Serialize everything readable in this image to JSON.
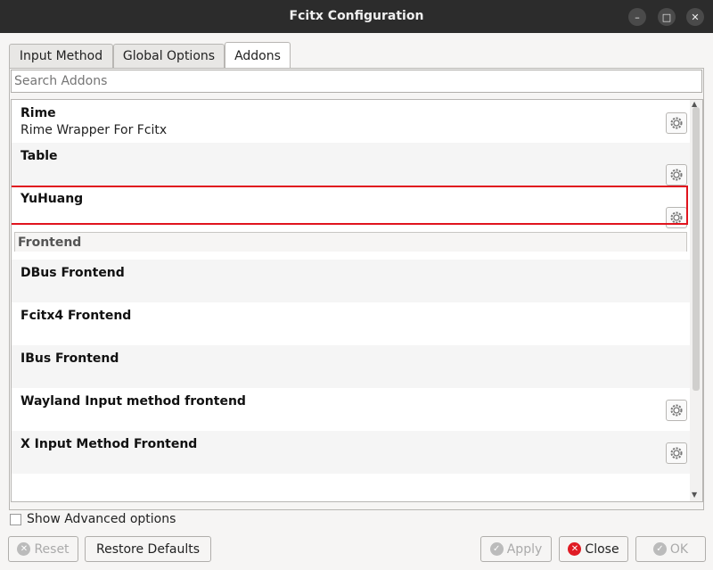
{
  "window": {
    "title": "Fcitx Configuration"
  },
  "tabs": [
    {
      "label": "Input Method"
    },
    {
      "label": "Global Options"
    },
    {
      "label": "Addons"
    }
  ],
  "search": {
    "placeholder": "Search Addons"
  },
  "addons": [
    {
      "name": "Rime",
      "description": "Rime Wrapper For Fcitx"
    },
    {
      "name": "Table",
      "description": ""
    },
    {
      "name": "YuHuang",
      "description": ""
    }
  ],
  "category": {
    "label": "Frontend"
  },
  "frontends": [
    {
      "name": "DBus Frontend"
    },
    {
      "name": "Fcitx4 Frontend"
    },
    {
      "name": "IBus Frontend"
    },
    {
      "name": "Wayland Input method frontend"
    },
    {
      "name": "X Input Method Frontend"
    }
  ],
  "options": {
    "show_advanced": "Show Advanced options",
    "show_advanced_checked": false
  },
  "buttons": {
    "reset": "Reset",
    "restore": "Restore Defaults",
    "apply": "Apply",
    "close": "Close",
    "ok": "OK"
  },
  "colors": {
    "titlebar": "#2c2c2c",
    "highlight": "#e0141e",
    "close_icon": "#e01b24"
  }
}
